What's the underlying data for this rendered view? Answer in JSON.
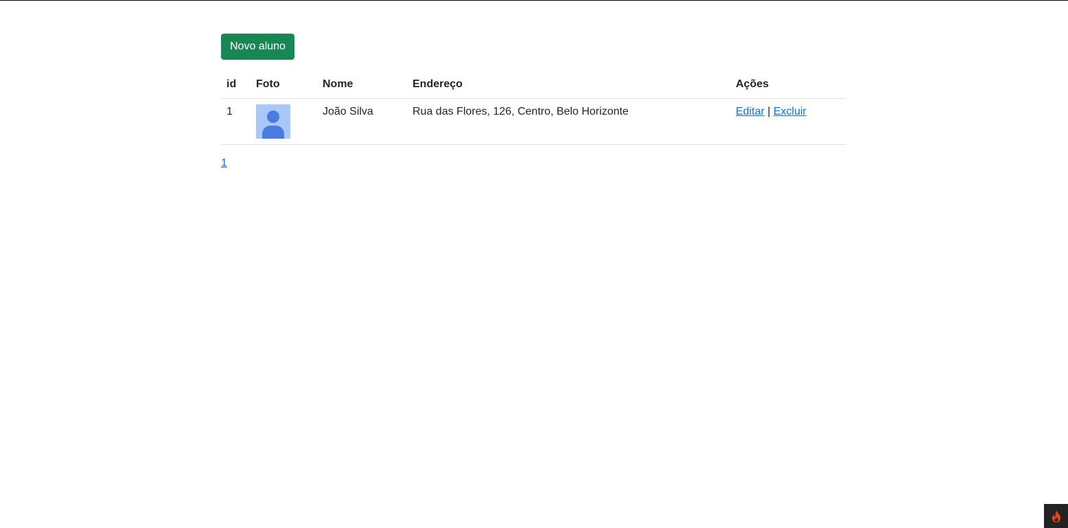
{
  "toolbar": {
    "new_button_label": "Novo aluno"
  },
  "table": {
    "headers": {
      "id": "id",
      "foto": "Foto",
      "nome": "Nome",
      "endereco": "Endereço",
      "acoes": "Ações"
    },
    "rows": [
      {
        "id": "1",
        "nome": "João Silva",
        "endereco": "Rua das Flores, 126, Centro, Belo Horizonte",
        "edit_label": "Editar",
        "separator": "|",
        "delete_label": "Excluir"
      }
    ]
  },
  "pagination": {
    "pages": [
      "1"
    ]
  },
  "icons": {
    "photo": "user-placeholder-icon",
    "debug_toolbar": "flame-icon"
  },
  "colors": {
    "primary_button": "#198754",
    "link": "#0d6efd",
    "photo_bg": "#a9c7f7",
    "photo_fg": "#4a7be0",
    "badge_bg": "#232323",
    "flame": "#dd4814"
  }
}
